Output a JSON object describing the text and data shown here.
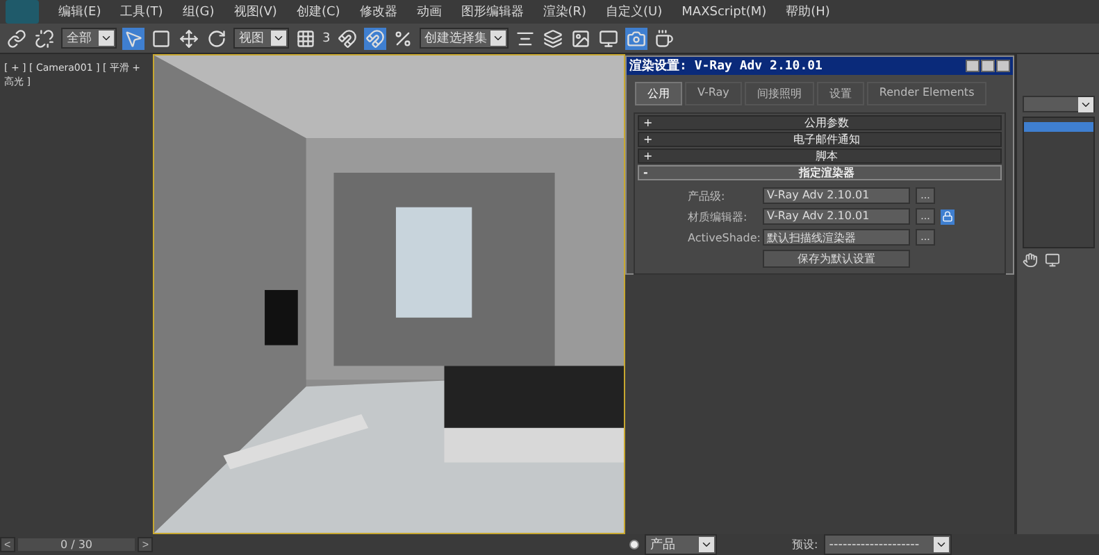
{
  "menu": [
    "编辑(E)",
    "工具(T)",
    "组(G)",
    "视图(V)",
    "创建(C)",
    "修改器",
    "动画",
    "图形编辑器",
    "渲染(R)",
    "自定义(U)",
    "MAXScript(M)",
    "帮助(H)"
  ],
  "toolbar": {
    "selection_filter": "全部",
    "reference_coord": "视图",
    "named_selection": "创建选择集",
    "snap_count": "3"
  },
  "viewport": {
    "label": "[ + ] [ Camera001 ] [ 平滑 + 高光 ]"
  },
  "timeline": {
    "prev": "<",
    "position": "0 / 30",
    "next": ">"
  },
  "render_dialog": {
    "title": "渲染设置: V-Ray Adv 2.10.01",
    "tabs": [
      {
        "label": "公用",
        "selected": true
      },
      {
        "label": "V-Ray",
        "selected": false
      },
      {
        "label": "间接照明",
        "selected": false
      },
      {
        "label": "设置",
        "selected": false
      },
      {
        "label": "Render Elements",
        "selected": false
      }
    ],
    "rollouts": [
      {
        "sign": "+",
        "title": "公用参数",
        "expanded": false
      },
      {
        "sign": "+",
        "title": "电子邮件通知",
        "expanded": false
      },
      {
        "sign": "+",
        "title": "脚本",
        "expanded": false
      },
      {
        "sign": "-",
        "title": "指定渲染器",
        "expanded": true
      }
    ],
    "renderer_rows": [
      {
        "label": "产品级:",
        "value": "V-Ray Adv 2.10.01",
        "button": "..."
      },
      {
        "label": "材质编辑器:",
        "value": "V-Ray Adv 2.10.01",
        "button": "...",
        "lock_on": true
      },
      {
        "label": "ActiveShade:",
        "value": "默认扫描线渲染器",
        "button": "..."
      }
    ],
    "save_button": "保存为默认设置"
  },
  "render_bar": {
    "mode_selected": true,
    "mode": "产品",
    "preset_label": "预设:",
    "preset": "--------------------"
  }
}
